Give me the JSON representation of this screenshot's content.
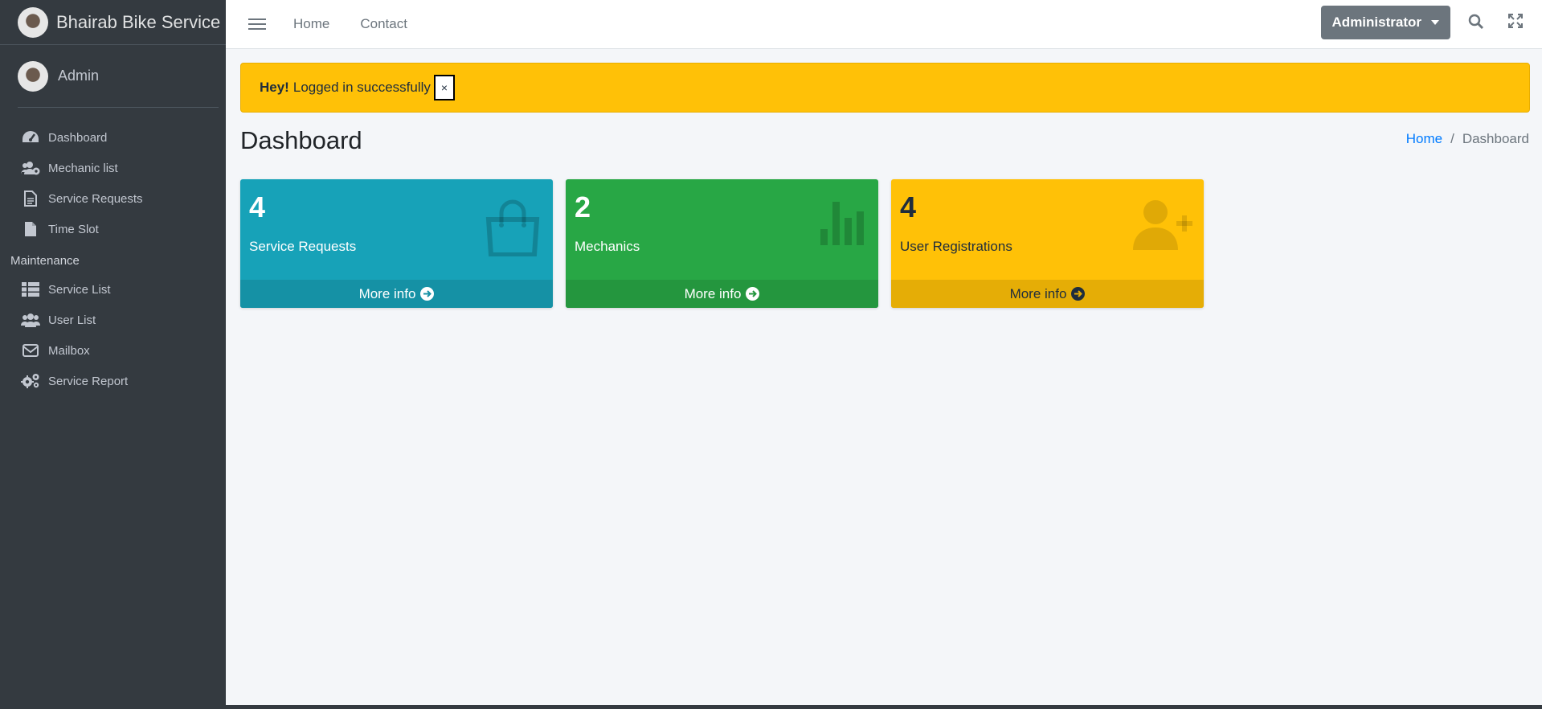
{
  "sidebar": {
    "brand": "Bhairab Bike Service",
    "user": "Admin",
    "items": [
      {
        "label": "Dashboard",
        "icon": "tachometer-icon"
      },
      {
        "label": "Mechanic list",
        "icon": "users-cog-icon"
      },
      {
        "label": "Service Requests",
        "icon": "file-alt-icon"
      },
      {
        "label": "Time Slot",
        "icon": "file-icon"
      }
    ],
    "header": "Maintenance",
    "items2": [
      {
        "label": "Service List",
        "icon": "th-list-icon"
      },
      {
        "label": "User List",
        "icon": "users-icon"
      },
      {
        "label": "Mailbox",
        "icon": "envelope-icon"
      },
      {
        "label": "Service Report",
        "icon": "cogs-icon"
      }
    ]
  },
  "topbar": {
    "home": "Home",
    "contact": "Contact",
    "user_menu": "Administrator"
  },
  "alert": {
    "strong": "Hey!",
    "message": "Logged in successfully",
    "close": "×"
  },
  "page": {
    "title": "Dashboard",
    "breadcrumb_home": "Home",
    "breadcrumb_sep": "/",
    "breadcrumb_current": "Dashboard"
  },
  "boxes": [
    {
      "value": "4",
      "label": "Service Requests",
      "footer": "More info",
      "color": "#17a2b8",
      "icon": "shopping-bag-icon"
    },
    {
      "value": "2",
      "label": "Mechanics",
      "footer": "More info",
      "color": "#28a745",
      "icon": "bar-chart-icon"
    },
    {
      "value": "4",
      "label": "User Registrations",
      "footer": "More info",
      "color": "#ffc107",
      "icon": "user-plus-icon"
    }
  ]
}
